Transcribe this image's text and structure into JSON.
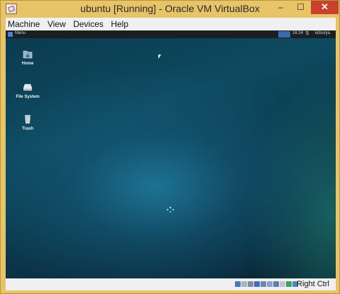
{
  "window": {
    "title": "ubuntu [Running] - Oracle VM VirtualBox",
    "minimize_glyph": "‒",
    "maximize_glyph": "☐",
    "close_glyph": "✕"
  },
  "menubar": {
    "items": [
      {
        "label": "Machine"
      },
      {
        "label": "View"
      },
      {
        "label": "Devices"
      },
      {
        "label": "Help"
      }
    ]
  },
  "guest_panel": {
    "menu_label": "Menu",
    "clock": "16:24",
    "network_glyph": "⇅",
    "user": "kdsurya"
  },
  "desktop_icons": [
    {
      "label": "Home",
      "icon": "home-folder-icon"
    },
    {
      "label": "File System",
      "icon": "drive-icon"
    },
    {
      "label": "Trash",
      "icon": "trash-icon"
    }
  ],
  "statusbar": {
    "host_key": "Right Ctrl",
    "indicators": [
      {
        "icon": "hard-disk-icon",
        "color": "#4a78c2"
      },
      {
        "icon": "optical-drive-icon",
        "color": "#a8b4c4"
      },
      {
        "icon": "audio-icon",
        "color": "#7d8fa8"
      },
      {
        "icon": "network-icon",
        "color": "#3f6fb5"
      },
      {
        "icon": "usb-icon",
        "color": "#6b86b0"
      },
      {
        "icon": "shared-folders-icon",
        "color": "#8aa3c6"
      },
      {
        "icon": "display-icon",
        "color": "#5d7fb8"
      },
      {
        "icon": "video-capture-icon",
        "color": "#c0c6d0"
      },
      {
        "icon": "mouse-integration-icon",
        "color": "#3da35d"
      },
      {
        "icon": "host-key-icon",
        "color": "#4e87c9"
      }
    ]
  }
}
